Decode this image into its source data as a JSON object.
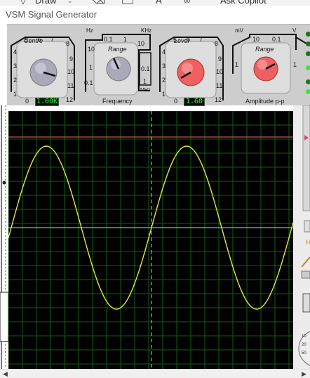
{
  "host_toolbar": {
    "draw_label": "Draw",
    "text_tool_label": "A",
    "ask_label": "Ask Copilot"
  },
  "window": {
    "title": "VSM Signal Generator"
  },
  "panel": {
    "frequency": {
      "centre": {
        "label": "Centre",
        "scale": [
          "5",
          "6",
          "7",
          "8",
          "4",
          "9",
          "3",
          "10",
          "2",
          "11",
          "1",
          "12",
          "0"
        ],
        "display": "1.00K"
      },
      "range": {
        "label": "Range",
        "left_scale": [
          "10",
          "1",
          "0.1"
        ],
        "top_scale": [
          "0.1",
          "1",
          "10"
        ],
        "right_scale": [
          "0.1",
          "1"
        ],
        "unit_hz": "Hz",
        "unit_khz": "KHz",
        "unit_mhz": "MHz"
      },
      "section_label": "Frequency"
    },
    "amplitude": {
      "level": {
        "label": "Level",
        "scale": [
          "5",
          "6",
          "7",
          "8",
          "4",
          "9",
          "3",
          "10",
          "2",
          "11",
          "1",
          "12",
          "0"
        ],
        "display": "1.60"
      },
      "range": {
        "label": "Range",
        "top_scale": [
          "10",
          "0.1"
        ],
        "left_scale": [
          "1"
        ],
        "right_scale": [
          "1"
        ],
        "unit_mv": "mV",
        "unit_v": "V"
      },
      "section_label": "Amplitude p-p"
    },
    "leds": [
      false,
      false,
      false,
      true,
      false,
      true
    ]
  },
  "scope": {
    "background": "#000000",
    "grid_color": "#0f5f0f",
    "trace_color": "#e8e840",
    "baseline_color": "#5fbfd6",
    "marker_color": "#d24a6a",
    "cycles_visible": 2
  },
  "colors": {
    "knob_grey": "#a9a9b9",
    "knob_red": "#f06060",
    "panel": "#cdcdcd"
  }
}
